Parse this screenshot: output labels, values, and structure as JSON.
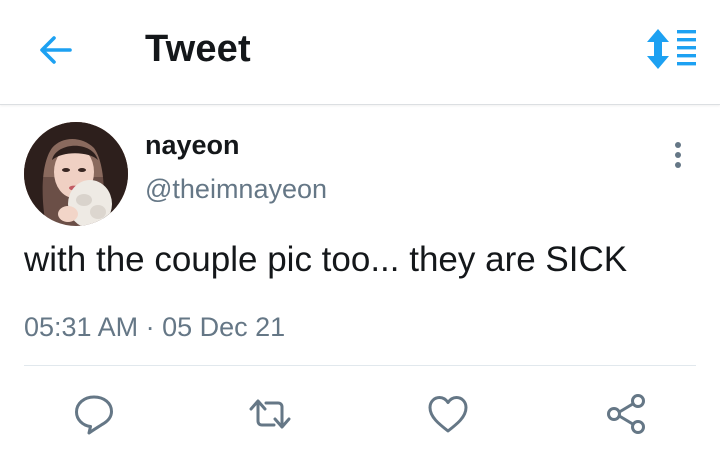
{
  "header": {
    "title": "Tweet",
    "back_icon": "arrow-left-icon",
    "sort_icon": "sort-list-icon"
  },
  "tweet": {
    "display_name": "nayeon",
    "handle": "@theimnayeon",
    "text": "with the couple pic too... they are SICK",
    "time": "05:31 AM",
    "separator": "·",
    "date": "05 Dec 21",
    "more_icon": "more-vertical-icon"
  },
  "actions": [
    {
      "name": "reply",
      "icon": "reply-icon"
    },
    {
      "name": "retweet",
      "icon": "retweet-icon"
    },
    {
      "name": "like",
      "icon": "heart-icon"
    },
    {
      "name": "share",
      "icon": "share-icon"
    }
  ],
  "colors": {
    "accent": "#1da1f2",
    "text_primary": "#14171a",
    "text_secondary": "#657786",
    "icon_gray": "#657786",
    "divider": "#e1e8ed"
  }
}
